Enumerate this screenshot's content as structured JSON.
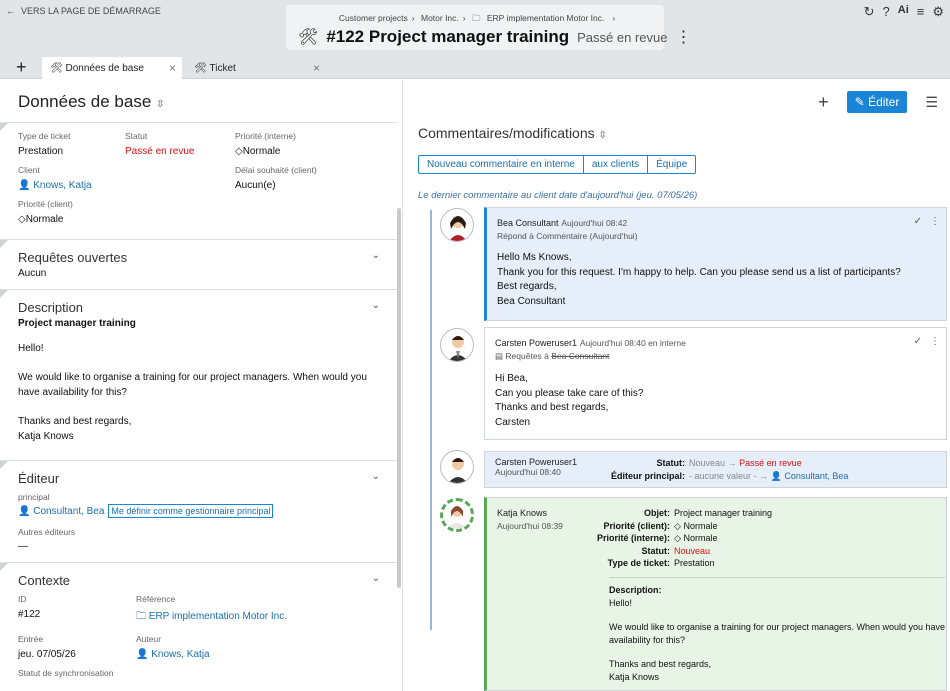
{
  "topbar": {
    "back_label": "VERS LA PAGE DE DÉMARRAGE",
    "crumbs": [
      "Customer projects",
      "Motor Inc.",
      "ERP implementation Motor Inc."
    ],
    "title": "#122 Project manager training",
    "status": "Passé en revue",
    "icons": [
      "refresh-icon",
      "help-icon",
      "ai-icon",
      "menu-icon",
      "gear-icon"
    ]
  },
  "tabs": [
    {
      "label": "Données de base"
    },
    {
      "label": "Ticket"
    }
  ],
  "left": {
    "title": "Données de base",
    "fields": {
      "type_label": "Type de ticket",
      "type_value": "Prestation",
      "status_label": "Statut",
      "status_value": "Passé en revue",
      "prio_int_label": "Priorité (interne)",
      "prio_int_value": "Normale",
      "client_label": "Client",
      "client_value": "Knows, Katja",
      "delay_label": "Délai souhaité (client)",
      "delay_value": "Aucun(e)",
      "prio_client_label": "Priorité (client)",
      "prio_client_value": "Normale"
    },
    "requests": {
      "title": "Requêtes ouvertes",
      "value": "Aucun"
    },
    "description": {
      "title": "Description",
      "subject": "Project manager training",
      "lines": [
        "Hello!",
        "We would like to organise a training for our project managers. When would you have availability for this?",
        "Thanks and best regards,",
        "Katja Knows"
      ]
    },
    "editor": {
      "title": "Éditeur",
      "principal_label": "principal",
      "principal_value": "Consultant, Bea",
      "assign_btn": "Me définir comme gestionnaire principal",
      "others_label": "Autres éditeurs",
      "others_value": "—"
    },
    "context": {
      "title": "Contexte",
      "id_label": "ID",
      "id_value": "#122",
      "ref_label": "Référence",
      "ref_value": "ERP implementation Motor Inc.",
      "entry_label": "Entrée",
      "entry_value": "jeu. 07/05/26",
      "author_label": "Auteur",
      "author_value": "Knows, Katja",
      "sync_label": "Statut de synchronisation"
    }
  },
  "right": {
    "edit_label": "Éditer",
    "comments_title": "Commentaires/modifications",
    "filters": [
      "Nouveau commentaire en interne",
      "aux clients",
      "Équipe"
    ],
    "note": "Le dernier commentaire au client date d'aujourd'hui (jeu. 07/05/26)",
    "c1": {
      "author": "Bea Consultant",
      "time": "Aujourd'hui 08:42",
      "reply": "Répond à Commentaire (Aujourd'hui)",
      "lines": [
        "Hello Ms Knows,",
        "Thank you for this request. I'm happy to help. Can you please send us a list of participants?",
        "Best regards,",
        "Bea Consultant"
      ]
    },
    "c2": {
      "author": "Carsten Poweruser1",
      "time": "Aujourd'hui 08:40 en interne",
      "req_prefix": "Requêtes à",
      "req_name": "Bea Consultant",
      "lines": [
        "Hi Bea,",
        "Can you please take care of this?",
        "Thanks and best regards,",
        "Carsten"
      ]
    },
    "c3": {
      "author": "Carsten Poweruser1",
      "time": "Aujourd'hui 08:40",
      "status_k": "Statut:",
      "status_from": "Nouveau",
      "status_to": "Passé en revue",
      "editor_k": "Éditeur principal:",
      "editor_from": "- aucune valeur -",
      "editor_to": "Consultant, Bea"
    },
    "c4": {
      "author": "Katja Knows",
      "time": "Aujourd'hui 08:39",
      "rows": [
        {
          "k": "Objet:",
          "v": "Project manager training"
        },
        {
          "k": "Priorité (client):",
          "v": "Normale"
        },
        {
          "k": "Priorité (interne):",
          "v": "Normale"
        },
        {
          "k": "Statut:",
          "v": "Nouveau"
        },
        {
          "k": "Type de ticket:",
          "v": "Prestation"
        }
      ],
      "desc_label": "Description:",
      "desc_lines": [
        "Hello!",
        "We would like to organise a training for our project managers. When would you have availability for this?",
        "Thanks and best regards,",
        "Katja Knows"
      ]
    }
  }
}
